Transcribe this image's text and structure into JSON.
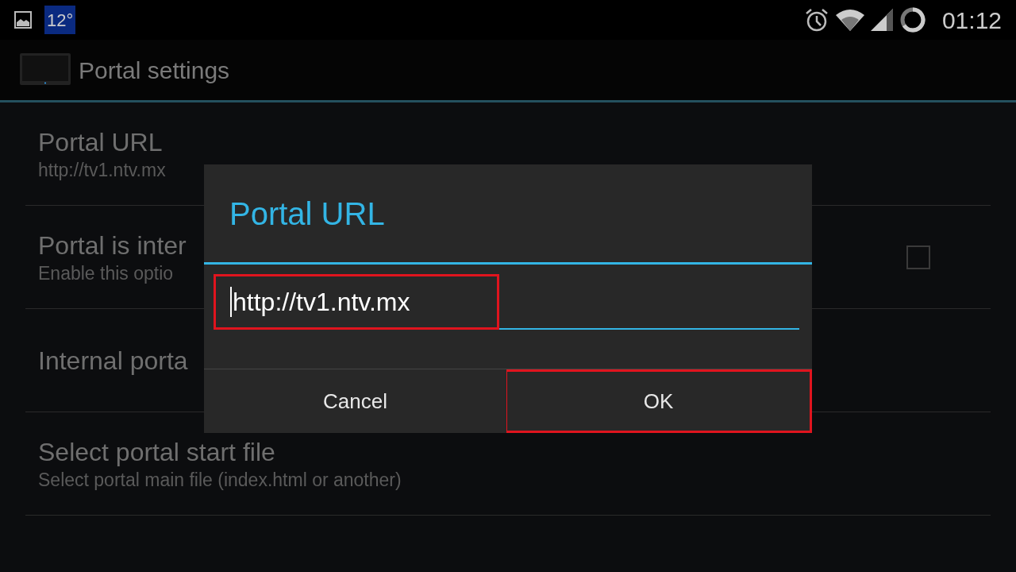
{
  "status_bar": {
    "weather": "12°",
    "time": "01:12"
  },
  "action_bar": {
    "title": "Portal settings"
  },
  "preferences": [
    {
      "kind": "text",
      "title": "Portal URL",
      "summary": "http://tv1.ntv.mx"
    },
    {
      "kind": "checkbox",
      "title": "Portal is inter",
      "summary": "Enable this optio",
      "checked": false
    },
    {
      "kind": "text",
      "title": "Internal porta"
    },
    {
      "kind": "text",
      "title": "Select portal start file",
      "summary": "Select portal main file (index.html or another)"
    }
  ],
  "dialog": {
    "title": "Portal URL",
    "field": {
      "value": "http://tv1.ntv.mx",
      "focused": true,
      "highlighted": true
    },
    "buttons": [
      {
        "label": "Cancel",
        "highlighted": false
      },
      {
        "label": "OK",
        "highlighted": true
      }
    ]
  }
}
